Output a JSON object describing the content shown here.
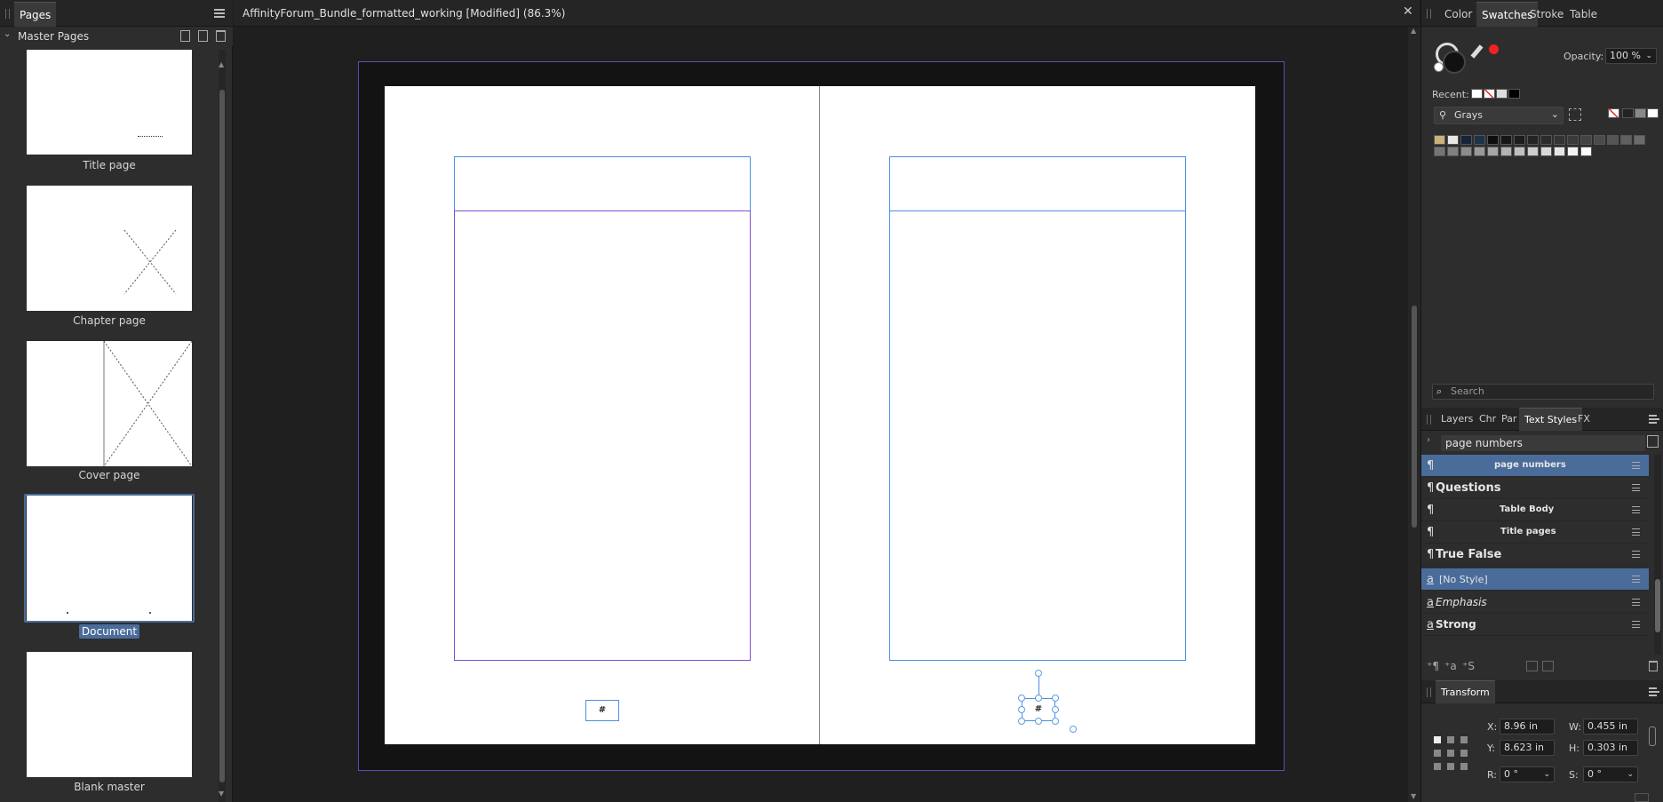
{
  "pages_panel": {
    "tab_label": "Pages",
    "section_label": "Master Pages",
    "masters": [
      {
        "label": "Title page"
      },
      {
        "label": "Chapter page"
      },
      {
        "label": "Cover page"
      },
      {
        "label": "Document",
        "selected": true
      },
      {
        "label": "Blank master"
      }
    ]
  },
  "document": {
    "title": "AffinityForum_Bundle_formatted_working [Modified] (86.3%)",
    "page_number_glyph": "#"
  },
  "color_panel": {
    "tabs": [
      "Color",
      "Swatches",
      "Stroke",
      "Table"
    ],
    "active_tab": "Swatches",
    "opacity_label": "Opacity:",
    "opacity_value": "100 %",
    "recent_label": "Recent:",
    "palette_name": "Grays",
    "search_placeholder": "Search",
    "palette_colors": [
      "#c8b27a",
      "#e8e8e8",
      "#18233a",
      "#1c3349",
      "#0e0e0e",
      "#161616",
      "#1d1d1d",
      "#242424",
      "#2b2b2b",
      "#333333",
      "#3a3a3a",
      "#434343",
      "#4b4b4b",
      "#555555",
      "#5f5f5f",
      "#6a6a6a",
      "#757575",
      "#808080",
      "#8c8c8c",
      "#999999",
      "#a6a6a6",
      "#b3b3b3",
      "#c0c0c0",
      "#cdcdcd",
      "#dadada",
      "#e6e6e6",
      "#f3f3f3",
      "#ffffff"
    ]
  },
  "styles_panel": {
    "tabs": [
      "Layers",
      "Chr",
      "Par",
      "Text Styles",
      "FX"
    ],
    "active_tab": "Text Styles",
    "current_style": "page numbers",
    "styles": [
      {
        "name": "page numbers",
        "kind": "¶",
        "selected": true
      },
      {
        "name": "Questions",
        "kind": "¶"
      },
      {
        "name": "Table Body",
        "kind": "¶"
      },
      {
        "name": "Title pages",
        "kind": "¶"
      },
      {
        "name": "True False",
        "kind": "¶"
      },
      {
        "name": "[No Style]",
        "kind": "a",
        "selected": true
      },
      {
        "name": "Emphasis",
        "kind": "a"
      },
      {
        "name": "Strong",
        "kind": "a"
      }
    ]
  },
  "transform_panel": {
    "title": "Transform",
    "x_label": "X:",
    "x_value": "8.96 in",
    "y_label": "Y:",
    "y_value": "8.623 in",
    "w_label": "W:",
    "w_value": "0.455 in",
    "h_label": "H:",
    "h_value": "0.303 in",
    "r_label": "R:",
    "r_value": "0 °",
    "s_label": "S:",
    "s_value": "0 °"
  },
  "colors": {
    "panel_bg": "#2d2d2d",
    "accent_blue": "#4a6c9b",
    "frame_blue": "#4a90e2",
    "frame_purple": "#7b4fd6"
  }
}
